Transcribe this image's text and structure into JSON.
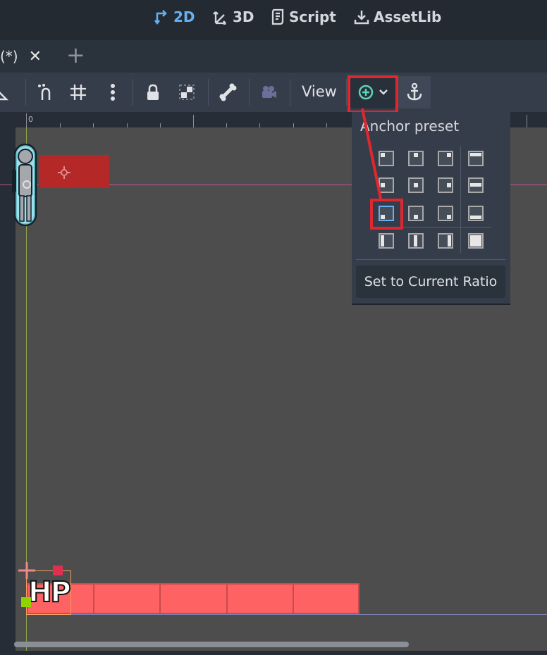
{
  "top_modes": [
    {
      "label": "2D",
      "icon": "2d-transform-icon",
      "active": true
    },
    {
      "label": "3D",
      "icon": "3d-transform-icon",
      "active": false
    },
    {
      "label": "Script",
      "icon": "script-icon",
      "active": false
    },
    {
      "label": "AssetLib",
      "icon": "download-icon",
      "active": false
    }
  ],
  "tabs": {
    "scene_tab_label": "(*)",
    "close_glyph": "✕",
    "add_glyph": "+"
  },
  "toolbar": {
    "view_label": "View"
  },
  "ruler": {
    "origin_label": "0"
  },
  "anchor_popup": {
    "title": "Anchor preset",
    "set_ratio_label": "Set to Current Ratio",
    "selected": "center-left"
  },
  "hud": {
    "hp_label": "HP"
  },
  "colors": {
    "accent": "#66b0f2",
    "highlight_box": "#e0262e",
    "hp_bar": "#ff6262",
    "enemy_rect": "#b52828"
  }
}
